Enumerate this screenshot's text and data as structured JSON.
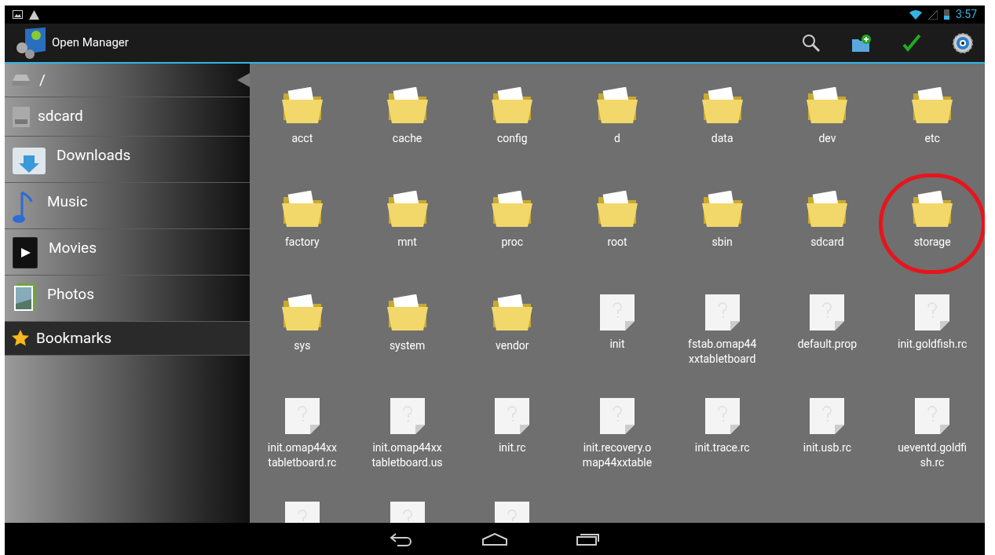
{
  "status_bar": {
    "time": "3:57"
  },
  "action_bar": {
    "title": "Open Manager"
  },
  "sidebar": {
    "items": [
      {
        "label": "/",
        "kind": "root",
        "selected": true
      },
      {
        "label": "sdcard",
        "kind": "sd",
        "selected": false
      },
      {
        "label": "Downloads",
        "kind": "downloads",
        "selected": false
      },
      {
        "label": "Music",
        "kind": "music",
        "selected": false
      },
      {
        "label": "Movies",
        "kind": "movies",
        "selected": false
      },
      {
        "label": "Photos",
        "kind": "photos",
        "selected": false
      }
    ],
    "section": {
      "label": "Bookmarks"
    }
  },
  "files": [
    {
      "kind": "folder",
      "lines": [
        "acct"
      ],
      "highlighted": false
    },
    {
      "kind": "folder",
      "lines": [
        "cache"
      ],
      "highlighted": false
    },
    {
      "kind": "folder",
      "lines": [
        "config"
      ],
      "highlighted": false
    },
    {
      "kind": "folder",
      "lines": [
        "d"
      ],
      "highlighted": false
    },
    {
      "kind": "folder",
      "lines": [
        "data"
      ],
      "highlighted": false
    },
    {
      "kind": "folder",
      "lines": [
        "dev"
      ],
      "highlighted": false
    },
    {
      "kind": "folder",
      "lines": [
        "etc"
      ],
      "highlighted": false
    },
    {
      "kind": "folder",
      "lines": [
        "factory"
      ],
      "highlighted": false
    },
    {
      "kind": "folder",
      "lines": [
        "mnt"
      ],
      "highlighted": false
    },
    {
      "kind": "folder",
      "lines": [
        "proc"
      ],
      "highlighted": false
    },
    {
      "kind": "folder",
      "lines": [
        "root"
      ],
      "highlighted": false
    },
    {
      "kind": "folder",
      "lines": [
        "sbin"
      ],
      "highlighted": false
    },
    {
      "kind": "folder",
      "lines": [
        "sdcard"
      ],
      "highlighted": false
    },
    {
      "kind": "folder",
      "lines": [
        "storage"
      ],
      "highlighted": true
    },
    {
      "kind": "folder",
      "lines": [
        "sys"
      ],
      "highlighted": false
    },
    {
      "kind": "folder",
      "lines": [
        "system"
      ],
      "highlighted": false
    },
    {
      "kind": "folder",
      "lines": [
        "vendor"
      ],
      "highlighted": false
    },
    {
      "kind": "file",
      "lines": [
        "init"
      ],
      "highlighted": false
    },
    {
      "kind": "file",
      "lines": [
        "fstab.omap44",
        "xxtabletboard"
      ],
      "highlighted": false
    },
    {
      "kind": "file",
      "lines": [
        "default.prop"
      ],
      "highlighted": false
    },
    {
      "kind": "file",
      "lines": [
        "init.goldfish.rc"
      ],
      "highlighted": false
    },
    {
      "kind": "file",
      "lines": [
        "init.omap44xx",
        "tabletboard.rc"
      ],
      "highlighted": false
    },
    {
      "kind": "file",
      "lines": [
        "init.omap44xx",
        "tabletboard.us"
      ],
      "highlighted": false
    },
    {
      "kind": "file",
      "lines": [
        "init.rc"
      ],
      "highlighted": false
    },
    {
      "kind": "file",
      "lines": [
        "init.recovery.o",
        "map44xxtable"
      ],
      "highlighted": false
    },
    {
      "kind": "file",
      "lines": [
        "init.trace.rc"
      ],
      "highlighted": false
    },
    {
      "kind": "file",
      "lines": [
        "init.usb.rc"
      ],
      "highlighted": false
    },
    {
      "kind": "file",
      "lines": [
        "ueventd.goldfi",
        "sh.rc"
      ],
      "highlighted": false
    },
    {
      "kind": "file",
      "highlighted": false
    },
    {
      "kind": "file",
      "highlighted": false
    },
    {
      "kind": "file",
      "highlighted": false
    }
  ]
}
